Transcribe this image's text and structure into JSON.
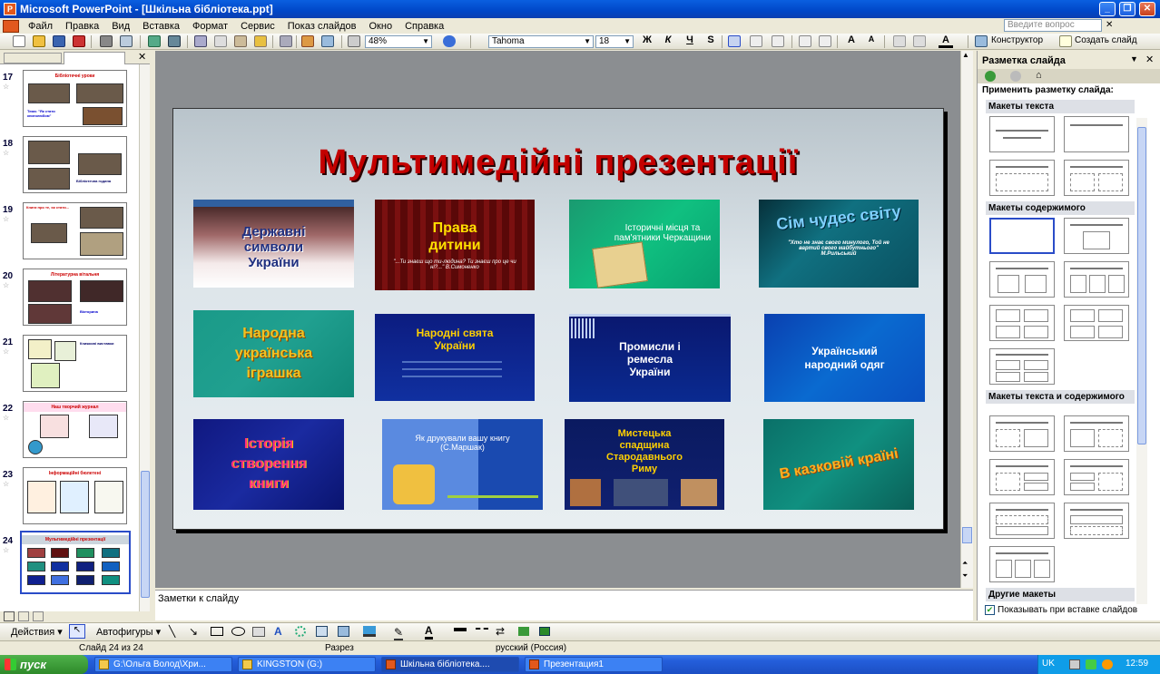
{
  "window": {
    "title": "Microsoft PowerPoint - [Шкільна бібліотека.ppt]"
  },
  "menu": [
    "Файл",
    "Правка",
    "Вид",
    "Вставка",
    "Формат",
    "Сервис",
    "Показ слайдов",
    "Окно",
    "Справка"
  ],
  "help_placeholder": "Введите вопрос",
  "toolbar": {
    "zoom": "48%",
    "font": "Tahoma",
    "size": "18",
    "bold": "Ж",
    "italic": "К",
    "underline": "Ч",
    "shadow": "S",
    "designer": "Конструктор",
    "new_slide": "Создать слайд"
  },
  "thumbnails": [
    {
      "num": "17",
      "title": "Бібліотечні уроки",
      "text": "Тема: \"Як стати книголюбом\""
    },
    {
      "num": "18",
      "title": "",
      "text": "Бібліотечна година"
    },
    {
      "num": "19",
      "title": "Книги про те, як стати...",
      "text": ""
    },
    {
      "num": "20",
      "title": "Літературна вітальня",
      "text": "Вікторина"
    },
    {
      "num": "21",
      "title": "",
      "text": "Книжкові виставки"
    },
    {
      "num": "22",
      "title": "Наш творчий журнал",
      "text": ""
    },
    {
      "num": "23",
      "title": "Інформаційні бюлетені",
      "text": ""
    },
    {
      "num": "24",
      "title": "Мультимедійні презентації",
      "text": ""
    }
  ],
  "slide": {
    "title": "Мультимедійні презентації",
    "items": [
      {
        "label": "Державні символи України",
        "sub": ""
      },
      {
        "label": "Права дитини",
        "sub": "\"...Ти знаєш що ти-людина? Ти знаєш про це чи ні?...\" В.Симоненко"
      },
      {
        "label": "Історичні місця та пам'ятники Черкащини",
        "sub": ""
      },
      {
        "label": "Сім чудес світу",
        "sub": "\"Хто не знає свого минулого, Той не вартий свого майбутнього\" М.Рильський"
      },
      {
        "label": "Народна українська іграшка",
        "sub": ""
      },
      {
        "label": "Народні свята України",
        "sub": ""
      },
      {
        "label": "Промисли і ремесла України",
        "sub": ""
      },
      {
        "label": "Український народний одяг",
        "sub": ""
      },
      {
        "label": "Історія створення книги",
        "sub": ""
      },
      {
        "label": "Як друкували вашу книгу (С.Маршак)",
        "sub": ""
      },
      {
        "label": "Мистецька спадщина Стародавнього Риму",
        "sub": ""
      },
      {
        "label": "В казковій країні",
        "sub": ""
      }
    ]
  },
  "notes_placeholder": "Заметки к слайду",
  "taskpane": {
    "title": "Разметка слайда",
    "apply_label": "Применить разметку слайда:",
    "sections": [
      "Макеты текста",
      "Макеты содержимого",
      "Макеты текста и содержимого",
      "Другие макеты"
    ],
    "show_on_insert": "Показывать при вставке слайдов"
  },
  "drawbar": {
    "actions": "Действия",
    "autoshapes": "Автофигуры"
  },
  "status": {
    "slide": "Слайд 24 из 24",
    "design": "Разрез",
    "lang": "русский (Россия)"
  },
  "taskbar": {
    "start": "пуск",
    "tasks": [
      "G:\\Ольга Волод\\Хри...",
      "KINGSTON (G:)",
      "Шкільна бібліотека....",
      "Презентация1"
    ],
    "lang": "UK",
    "time": "12:59"
  }
}
